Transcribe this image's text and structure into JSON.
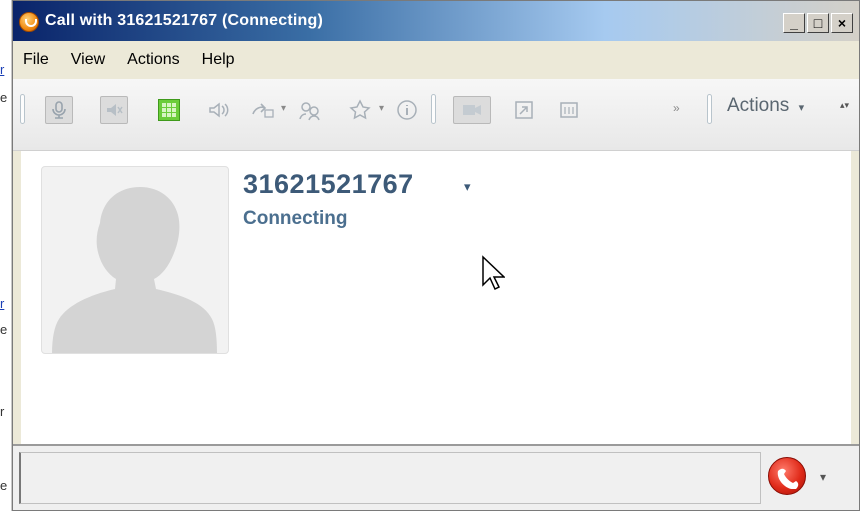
{
  "window": {
    "title": "Call with 31621521767 (Connecting)",
    "controls": {
      "minimize": "_",
      "maximize": "□",
      "close": "×"
    }
  },
  "menu": {
    "items": [
      "File",
      "View",
      "Actions",
      "Help"
    ]
  },
  "toolbar": {
    "actions_label": "Actions",
    "actions_caret": "▾",
    "overflow_glyph": "»",
    "scroll_glyph": "▴▾",
    "icons": [
      "microphone-icon",
      "speaker-mute-icon",
      "keypad-icon",
      "volume-icon",
      "transfer-icon",
      "conference-icon",
      "favorite-icon",
      "info-icon",
      "video-icon",
      "share-screen-icon",
      "whiteboard-icon"
    ]
  },
  "contact": {
    "number": "31621521767",
    "status": "Connecting",
    "caret": "▾"
  },
  "bottom": {
    "hangup_caret": "▾"
  },
  "behind_app": {
    "fragments": [
      "r",
      "e",
      "r",
      "e",
      "r",
      "e"
    ]
  },
  "colors": {
    "title_gradient_start": "#0a246a",
    "contact_text": "#3d5a78",
    "hangup_red": "#e02b1a",
    "keypad_green": "#6ccd3a"
  }
}
